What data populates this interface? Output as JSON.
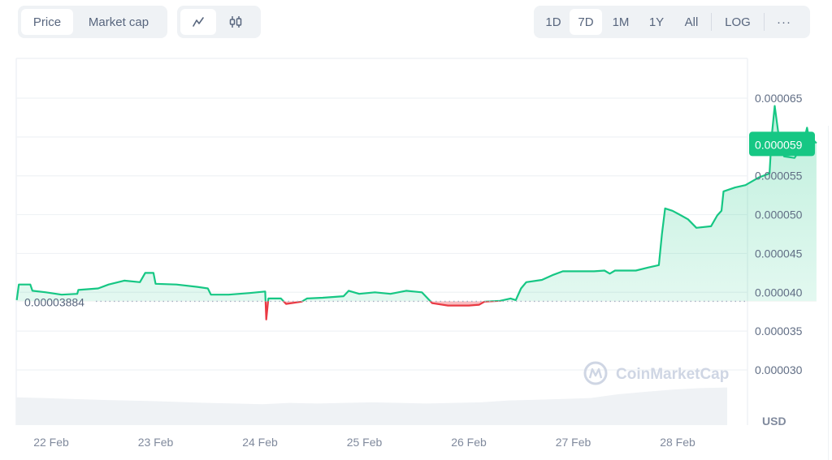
{
  "toolbar": {
    "metric_tabs": [
      {
        "label": "Price",
        "active": true
      },
      {
        "label": "Market cap",
        "active": false
      }
    ],
    "chart_types": [
      {
        "icon": "line-chart-icon",
        "active": true
      },
      {
        "icon": "candlestick-icon",
        "active": false
      }
    ],
    "ranges": [
      {
        "label": "1D",
        "active": false
      },
      {
        "label": "7D",
        "active": true
      },
      {
        "label": "1M",
        "active": false
      },
      {
        "label": "1Y",
        "active": false
      },
      {
        "label": "All",
        "active": false
      }
    ],
    "log_label": "LOG",
    "more_label": "···"
  },
  "colors": {
    "up": "#16c784",
    "down": "#ea3943",
    "grid": "#eff2f5",
    "volume": "#eff2f5",
    "badge": "#16c784"
  },
  "watermark": "CoinMarketCap",
  "currency_label": "USD",
  "chart_data": {
    "type": "line",
    "title": "",
    "xlabel": "",
    "ylabel": "USD",
    "x_tick_labels": [
      "22 Feb",
      "23 Feb",
      "24 Feb",
      "25 Feb",
      "26 Feb",
      "27 Feb",
      "28 Feb"
    ],
    "x_range_days": [
      -0.33,
      6.67
    ],
    "y_tick_labels": [
      "0.000030",
      "0.000035",
      "0.000040",
      "0.000045",
      "0.000050",
      "0.000055",
      "0.000065"
    ],
    "y_ticks": [
      3e-05,
      3.5e-05,
      4e-05,
      4.5e-05,
      5e-05,
      5.5e-05,
      6e-05,
      6.5e-05
    ],
    "ylim": [
      2.75e-05,
      7e-05
    ],
    "grid": true,
    "baseline": {
      "value": 3.884e-05,
      "label": "0.00003884"
    },
    "current_price": {
      "value": 5.9e-05,
      "label": "0.000059"
    },
    "series": [
      {
        "name": "Price",
        "points": [
          [
            -0.33,
            3.9e-05
          ],
          [
            -0.31,
            4.1e-05
          ],
          [
            -0.2,
            4.1e-05
          ],
          [
            -0.18,
            4.02e-05
          ],
          [
            -0.05,
            4e-05
          ],
          [
            0.1,
            3.97e-05
          ],
          [
            0.25,
            3.98e-05
          ],
          [
            0.26,
            4.03e-05
          ],
          [
            0.45,
            4.05e-05
          ],
          [
            0.55,
            4.1e-05
          ],
          [
            0.7,
            4.15e-05
          ],
          [
            0.85,
            4.13e-05
          ],
          [
            0.9,
            4.25e-05
          ],
          [
            0.98,
            4.25e-05
          ],
          [
            1.0,
            4.11e-05
          ],
          [
            1.2,
            4.1e-05
          ],
          [
            1.4,
            4.07e-05
          ],
          [
            1.5,
            4.05e-05
          ],
          [
            1.53,
            3.97e-05
          ],
          [
            1.7,
            3.97e-05
          ],
          [
            1.9,
            3.99e-05
          ],
          [
            2.05,
            4.01e-05
          ],
          [
            2.06,
            3.65e-05
          ],
          [
            2.08,
            3.92e-05
          ],
          [
            2.2,
            3.92e-05
          ],
          [
            2.25,
            3.85e-05
          ],
          [
            2.4,
            3.88e-05
          ],
          [
            2.45,
            3.92e-05
          ],
          [
            2.6,
            3.93e-05
          ],
          [
            2.8,
            3.95e-05
          ],
          [
            2.85,
            4.02e-05
          ],
          [
            2.95,
            3.98e-05
          ],
          [
            3.1,
            4e-05
          ],
          [
            3.25,
            3.98e-05
          ],
          [
            3.4,
            4.02e-05
          ],
          [
            3.55,
            4e-05
          ],
          [
            3.65,
            3.86e-05
          ],
          [
            3.8,
            3.83e-05
          ],
          [
            4.0,
            3.83e-05
          ],
          [
            4.1,
            3.84e-05
          ],
          [
            4.15,
            3.88e-05
          ],
          [
            4.3,
            3.89e-05
          ],
          [
            4.4,
            3.92e-05
          ],
          [
            4.45,
            3.9e-05
          ],
          [
            4.5,
            4.05e-05
          ],
          [
            4.55,
            4.13e-05
          ],
          [
            4.7,
            4.16e-05
          ],
          [
            4.8,
            4.22e-05
          ],
          [
            4.9,
            4.27e-05
          ],
          [
            5.2,
            4.27e-05
          ],
          [
            5.3,
            4.28e-05
          ],
          [
            5.35,
            4.24e-05
          ],
          [
            5.4,
            4.28e-05
          ],
          [
            5.6,
            4.28e-05
          ],
          [
            5.72,
            4.32e-05
          ],
          [
            5.82,
            4.35e-05
          ],
          [
            5.85,
            4.75e-05
          ],
          [
            5.88,
            5.08e-05
          ],
          [
            5.95,
            5.05e-05
          ],
          [
            6.02,
            5e-05
          ],
          [
            6.1,
            4.94e-05
          ],
          [
            6.18,
            4.83e-05
          ],
          [
            6.32,
            4.85e-05
          ],
          [
            6.38,
            4.99e-05
          ],
          [
            6.42,
            5.05e-05
          ],
          [
            6.44,
            5.3e-05
          ],
          [
            6.55,
            5.35e-05
          ],
          [
            6.65,
            5.38e-05
          ],
          [
            6.78,
            5.48e-05
          ],
          [
            6.88,
            5.53e-05
          ],
          [
            6.9,
            6e-05
          ],
          [
            6.93,
            6.4e-05
          ],
          [
            6.97,
            6e-05
          ],
          [
            7.02,
            5.75e-05
          ],
          [
            7.12,
            5.73e-05
          ],
          [
            7.2,
            5.9e-05
          ],
          [
            7.24,
            6.12e-05
          ],
          [
            7.27,
            5.9e-05
          ],
          [
            7.3,
            5.96e-05
          ],
          [
            7.33,
            5.92e-05
          ]
        ]
      }
    ],
    "volume_relative": [
      0.9,
      0.88,
      0.85,
      0.82,
      0.8,
      0.78,
      0.75,
      0.72,
      0.7,
      0.68,
      0.72,
      0.7,
      0.72,
      0.74,
      0.72,
      0.7,
      0.72,
      0.74,
      0.8,
      0.82,
      0.85,
      0.88,
      1.0,
      1.08,
      1.15,
      1.2,
      1.22
    ]
  }
}
